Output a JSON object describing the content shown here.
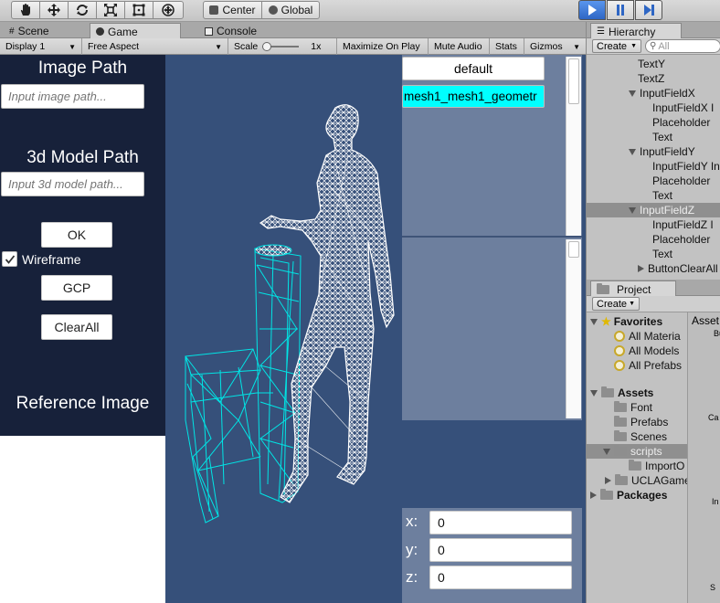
{
  "toolbar": {
    "pivot_label": "Center",
    "handle_label": "Global"
  },
  "tabs": {
    "scene": "Scene",
    "game": "Game",
    "console": "Console"
  },
  "gamebar": {
    "display": "Display 1",
    "aspect": "Free Aspect",
    "scale_label": "Scale",
    "scale_value": "1x",
    "maximize": "Maximize On Play",
    "mute": "Mute Audio",
    "stats": "Stats",
    "gizmos": "Gizmos"
  },
  "left_panel": {
    "image_path_title": "Image Path",
    "image_path_placeholder": "Input image path...",
    "model_path_title": "3d Model Path",
    "model_path_placeholder": "Input 3d model path...",
    "ok_label": "OK",
    "wireframe_label": "Wireframe",
    "wireframe_checked": true,
    "gcp_label": "GCP",
    "clear_label": "ClearAll",
    "reference_title": "Reference Image"
  },
  "mesh_panel": {
    "default_label": "default",
    "mesh_item": "mesh1_mesh1_geometr"
  },
  "coords": {
    "x_label": "x:",
    "x_value": "0",
    "y_label": "y:",
    "y_value": "0",
    "z_label": "z:",
    "z_value": "0"
  },
  "hierarchy": {
    "tab": "Hierarchy",
    "create": "Create",
    "search_placeholder": "All",
    "rows": [
      {
        "label": "TextY",
        "indent": 0,
        "arrow": ""
      },
      {
        "label": "TextZ",
        "indent": 0,
        "arrow": ""
      },
      {
        "label": "InputFieldX",
        "indent": 1,
        "arrow": "down"
      },
      {
        "label": "InputFieldX I",
        "indent": 2,
        "arrow": ""
      },
      {
        "label": "Placeholder",
        "indent": 2,
        "arrow": ""
      },
      {
        "label": "Text",
        "indent": 2,
        "arrow": ""
      },
      {
        "label": "InputFieldY",
        "indent": 1,
        "arrow": "down"
      },
      {
        "label": "InputFieldY In",
        "indent": 2,
        "arrow": ""
      },
      {
        "label": "Placeholder",
        "indent": 2,
        "arrow": ""
      },
      {
        "label": "Text",
        "indent": 2,
        "arrow": ""
      },
      {
        "label": "InputFieldZ",
        "indent": 1,
        "arrow": "down",
        "selected": true
      },
      {
        "label": "InputFieldZ I",
        "indent": 2,
        "arrow": ""
      },
      {
        "label": "Placeholder",
        "indent": 2,
        "arrow": ""
      },
      {
        "label": "Text",
        "indent": 2,
        "arrow": ""
      },
      {
        "label": "ButtonClearAll",
        "indent": 0,
        "arrow": "right"
      }
    ]
  },
  "project": {
    "tab": "Project",
    "create": "Create",
    "favorites": "Favorites",
    "fav_items": [
      "All Materia",
      "All Models",
      "All Prefabs"
    ],
    "assets": "Assets",
    "asset_items": [
      "Font",
      "Prefabs",
      "Scenes",
      "scripts"
    ],
    "script_child": "ImportO",
    "ucla": "UCLAGame",
    "packages": "Packages",
    "right_header": "Asset",
    "right_fragments": [
      "Bu",
      "Ca",
      "In",
      "S"
    ]
  },
  "colors": {
    "game_bg": "#36507a",
    "left_panel_bg": "#17213a",
    "panel_bg": "#6d7f9e",
    "mesh_highlight": "#00ffff",
    "wire_chair": "#00e5e5",
    "wire_human": "#ffffff",
    "play_active": "#3d7bd9"
  }
}
